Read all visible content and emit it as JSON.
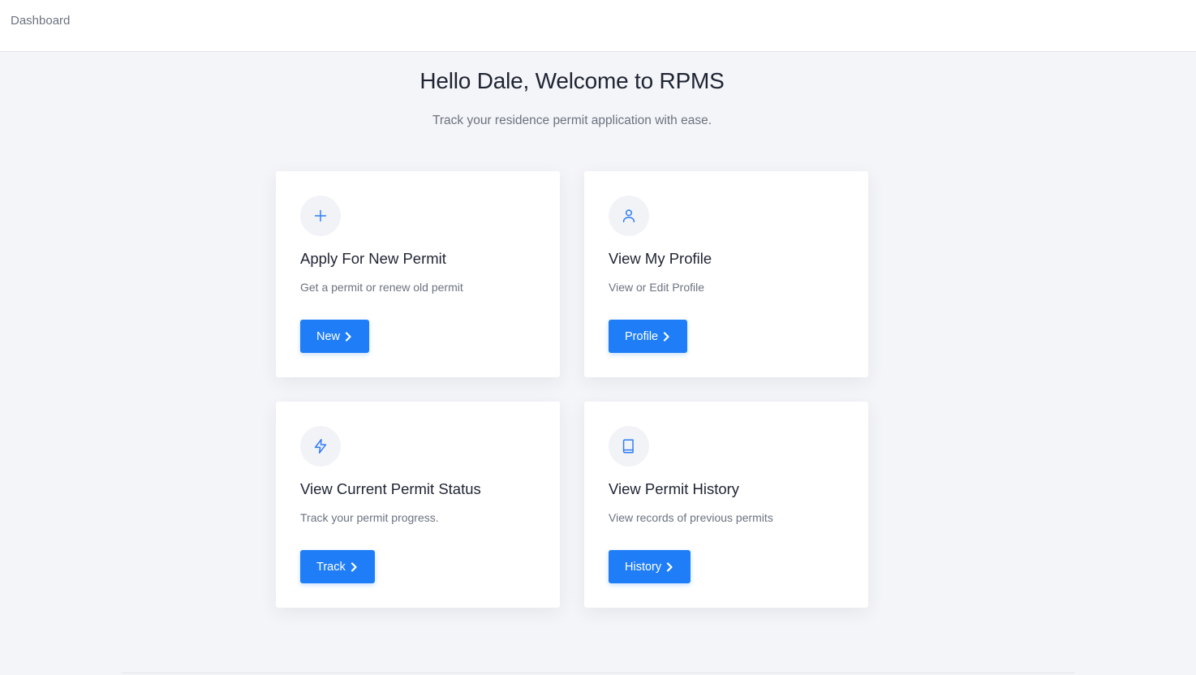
{
  "topbar": {
    "breadcrumb": "Dashboard"
  },
  "welcome": {
    "title": "Hello Dale, Welcome to RPMS",
    "subtitle": "Track your residence permit application with ease."
  },
  "cards": [
    {
      "icon": "plus-icon",
      "title": "Apply For New Permit",
      "description": "Get a permit or renew old permit",
      "button_label": "New"
    },
    {
      "icon": "user-icon",
      "title": "View My Profile",
      "description": "View or Edit Profile",
      "button_label": "Profile"
    },
    {
      "icon": "lightning-icon",
      "title": "View Current Permit Status",
      "description": "Track your permit progress.",
      "button_label": "Track"
    },
    {
      "icon": "book-icon",
      "title": "View Permit History",
      "description": "View records of previous permits",
      "button_label": "History"
    }
  ],
  "colors": {
    "accent": "#1f7ef7",
    "background": "#f4f5f8",
    "icon_circle": "#f1f3f7"
  }
}
